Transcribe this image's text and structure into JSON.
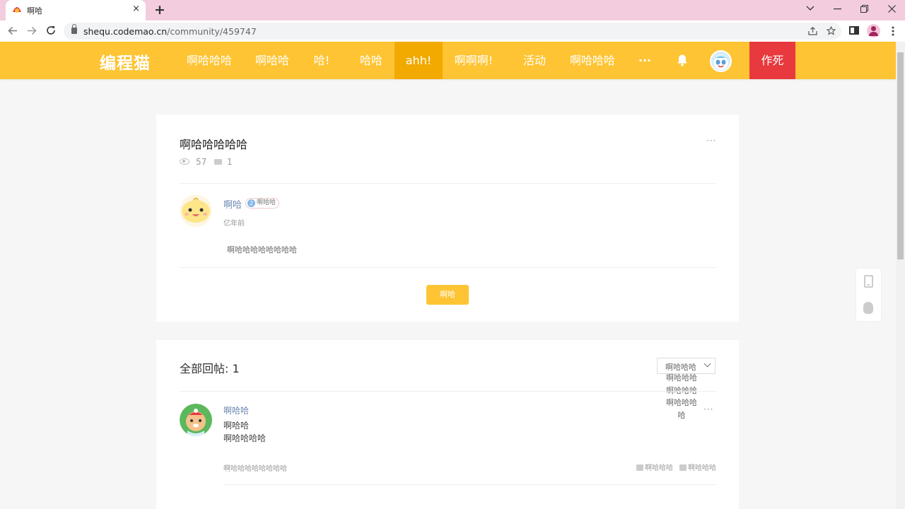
{
  "browser": {
    "tab_title": "啊哈",
    "tab_close": "×",
    "new_tab": "+",
    "url_domain": "shequ.codemao.cn",
    "url_path": "/community/459747",
    "window_buttons": [
      "chevron-down",
      "minimize",
      "restore",
      "close"
    ]
  },
  "header": {
    "logo": "编程猫",
    "nav": [
      "啊哈哈哈",
      "啊哈哈",
      "哈!",
      "哈哈",
      "ahh!",
      "啊啊啊!",
      "活动",
      "啊哈哈哈"
    ],
    "active_nav": "ahh!",
    "more": "···",
    "create_button": "作死",
    "colors": {
      "header_bg": "#fec433",
      "active_bg": "#f2a900",
      "create_bg": "#e8393e",
      "link": "#6a86b0"
    }
  },
  "post": {
    "title": "啊哈哈哈哈哈",
    "views": "57",
    "comments": "1",
    "more": "···",
    "author": {
      "name": "啊哈",
      "level": "2",
      "badge": "啊哈哈"
    },
    "time": "亿年前",
    "body": "啊哈哈哈哈哈哈哈哈",
    "reply_button": "啊哈"
  },
  "replies": {
    "title": "全部回帖: 1",
    "sort_selected": "啊哈哈哈",
    "sort_options": [
      "啊哈哈哈",
      "啊哈哈哈",
      "啊哈哈哈",
      "哈"
    ],
    "items": [
      {
        "author": "啊哈哈",
        "lines": [
          "啊哈哈",
          "啊哈哈哈哈"
        ],
        "time": "啊哈哈哈哈哈哈哈哈",
        "like_label": "啊哈哈哈",
        "reply_label": "啊哈哈哈",
        "more": "···"
      }
    ]
  }
}
